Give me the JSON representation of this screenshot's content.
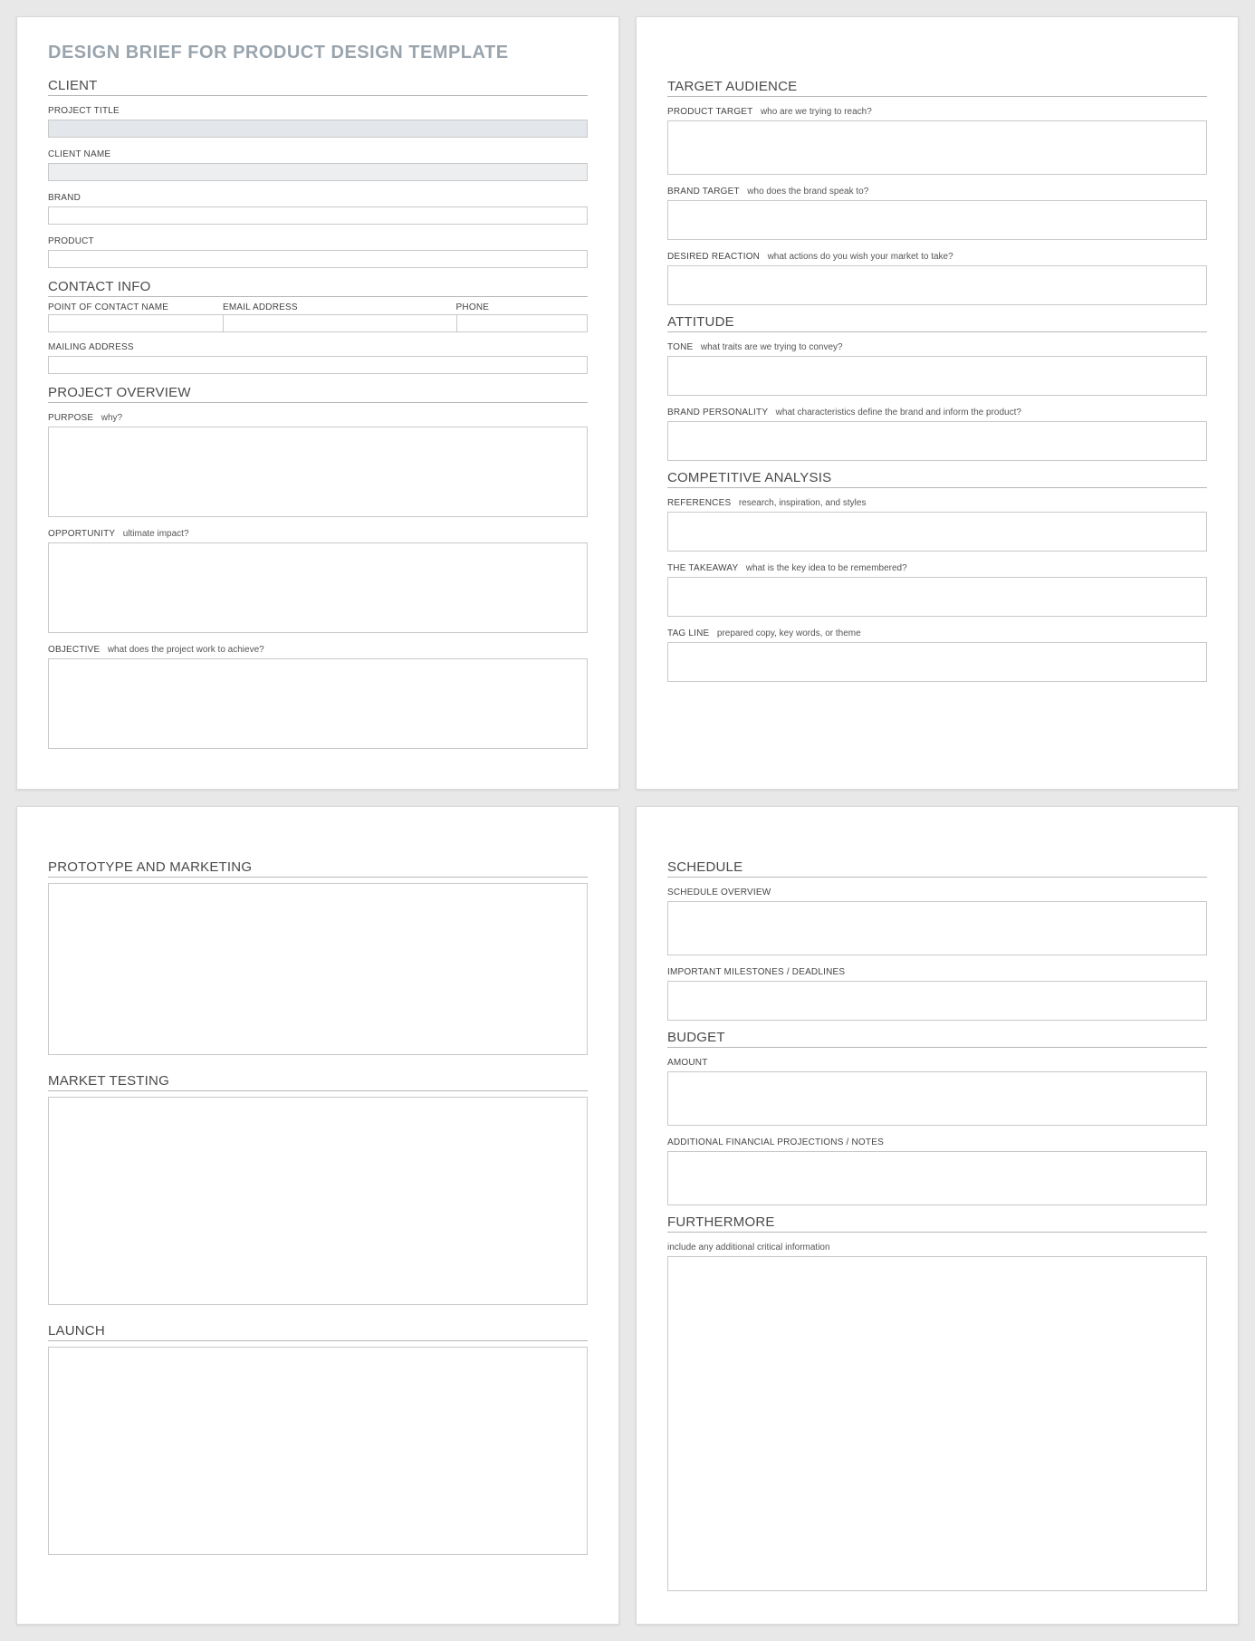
{
  "doc_title": "DESIGN BRIEF FOR PRODUCT DESIGN TEMPLATE",
  "page1": {
    "client_heading": "CLIENT",
    "project_title_label": "PROJECT TITLE",
    "client_name_label": "CLIENT NAME",
    "brand_label": "BRAND",
    "product_label": "PRODUCT",
    "contact_heading": "CONTACT INFO",
    "poc_label": "POINT OF CONTACT NAME",
    "email_label": "EMAIL ADDRESS",
    "phone_label": "PHONE",
    "mailing_label": "MAILING ADDRESS",
    "overview_heading": "PROJECT OVERVIEW",
    "purpose_label": "PURPOSE",
    "purpose_hint": "why?",
    "opportunity_label": "OPPORTUNITY",
    "opportunity_hint": "ultimate impact?",
    "objective_label": "OBJECTIVE",
    "objective_hint": "what does the project work to achieve?"
  },
  "page2": {
    "audience_heading": "TARGET AUDIENCE",
    "product_target_label": "PRODUCT TARGET",
    "product_target_hint": "who are we trying to reach?",
    "brand_target_label": "BRAND TARGET",
    "brand_target_hint": "who does the brand speak to?",
    "desired_reaction_label": "DESIRED REACTION",
    "desired_reaction_hint": "what actions do you wish your market to take?",
    "attitude_heading": "ATTITUDE",
    "tone_label": "TONE",
    "tone_hint": "what traits are we trying to convey?",
    "brand_personality_label": "BRAND PERSONALITY",
    "brand_personality_hint": "what characteristics define the brand and inform the product?",
    "competitive_heading": "COMPETITIVE ANALYSIS",
    "references_label": "REFERENCES",
    "references_hint": "research, inspiration, and styles",
    "takeaway_label": "THE TAKEAWAY",
    "takeaway_hint": "what is the key idea to be remembered?",
    "tagline_label": "TAG LINE",
    "tagline_hint": "prepared copy, key words, or theme"
  },
  "page3": {
    "prototype_heading": "PROTOTYPE AND MARKETING",
    "market_testing_heading": "MARKET TESTING",
    "launch_heading": "LAUNCH"
  },
  "page4": {
    "schedule_heading": "SCHEDULE",
    "schedule_overview_label": "SCHEDULE OVERVIEW",
    "milestones_label": "IMPORTANT MILESTONES / DEADLINES",
    "budget_heading": "BUDGET",
    "amount_label": "AMOUNT",
    "financial_notes_label": "ADDITIONAL FINANCIAL PROJECTIONS / NOTES",
    "furthermore_heading": "FURTHERMORE",
    "furthermore_hint": "include any additional critical information"
  }
}
